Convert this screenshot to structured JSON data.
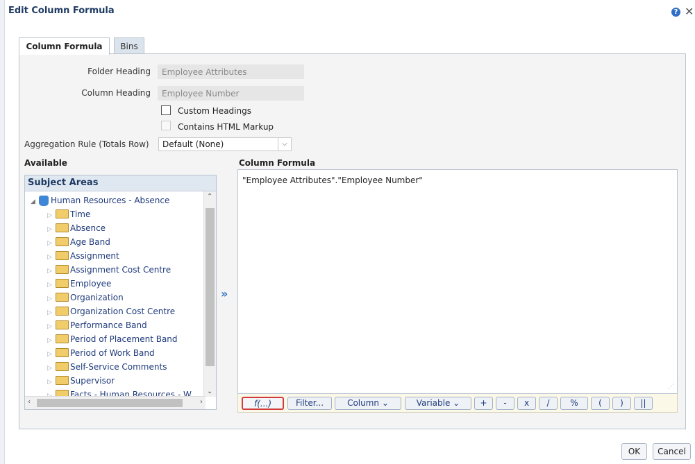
{
  "dialog": {
    "title": "Edit Column Formula",
    "help_icon": "help-icon",
    "close_icon": "close-icon"
  },
  "tabs": [
    {
      "label": "Column Formula",
      "active": true
    },
    {
      "label": "Bins",
      "active": false
    }
  ],
  "form": {
    "folder_heading_label": "Folder Heading",
    "folder_heading_value": "Employee Attributes",
    "column_heading_label": "Column Heading",
    "column_heading_value": "Employee Number",
    "custom_headings_label": "Custom Headings",
    "custom_headings_checked": false,
    "contains_html_label": "Contains HTML Markup",
    "contains_html_checked": false,
    "aggregation_label": "Aggregation Rule (Totals Row)",
    "aggregation_value": "Default (None)"
  },
  "available": {
    "title": "Available",
    "subject_areas_title": "Subject Areas",
    "root": "Human Resources - Absence",
    "folders": [
      "Time",
      "Absence",
      "Age Band",
      "Assignment",
      "Assignment Cost Centre",
      "Employee",
      "Organization",
      "Organization Cost Centre",
      "Performance Band",
      "Period of Placement Band",
      "Period of Work Band",
      "Self-Service Comments",
      "Supervisor",
      "Facts - Human Resources - W"
    ]
  },
  "column_formula": {
    "title": "Column Formula",
    "text": "\"Employee Attributes\".\"Employee Number\""
  },
  "toolbar": {
    "fx": "f(...)",
    "filter": "Filter...",
    "column": "Column ⌄",
    "variable": "Variable ⌄",
    "plus": "+",
    "minus": "-",
    "times": "x",
    "divide": "/",
    "percent": "%",
    "open_paren": "(",
    "close_paren": ")",
    "concat": "||"
  },
  "buttons": {
    "ok": "OK",
    "cancel": "Cancel"
  },
  "colors": {
    "title": "#1f3b63",
    "link": "#1e3a7b",
    "highlight": "#d23a3a"
  }
}
